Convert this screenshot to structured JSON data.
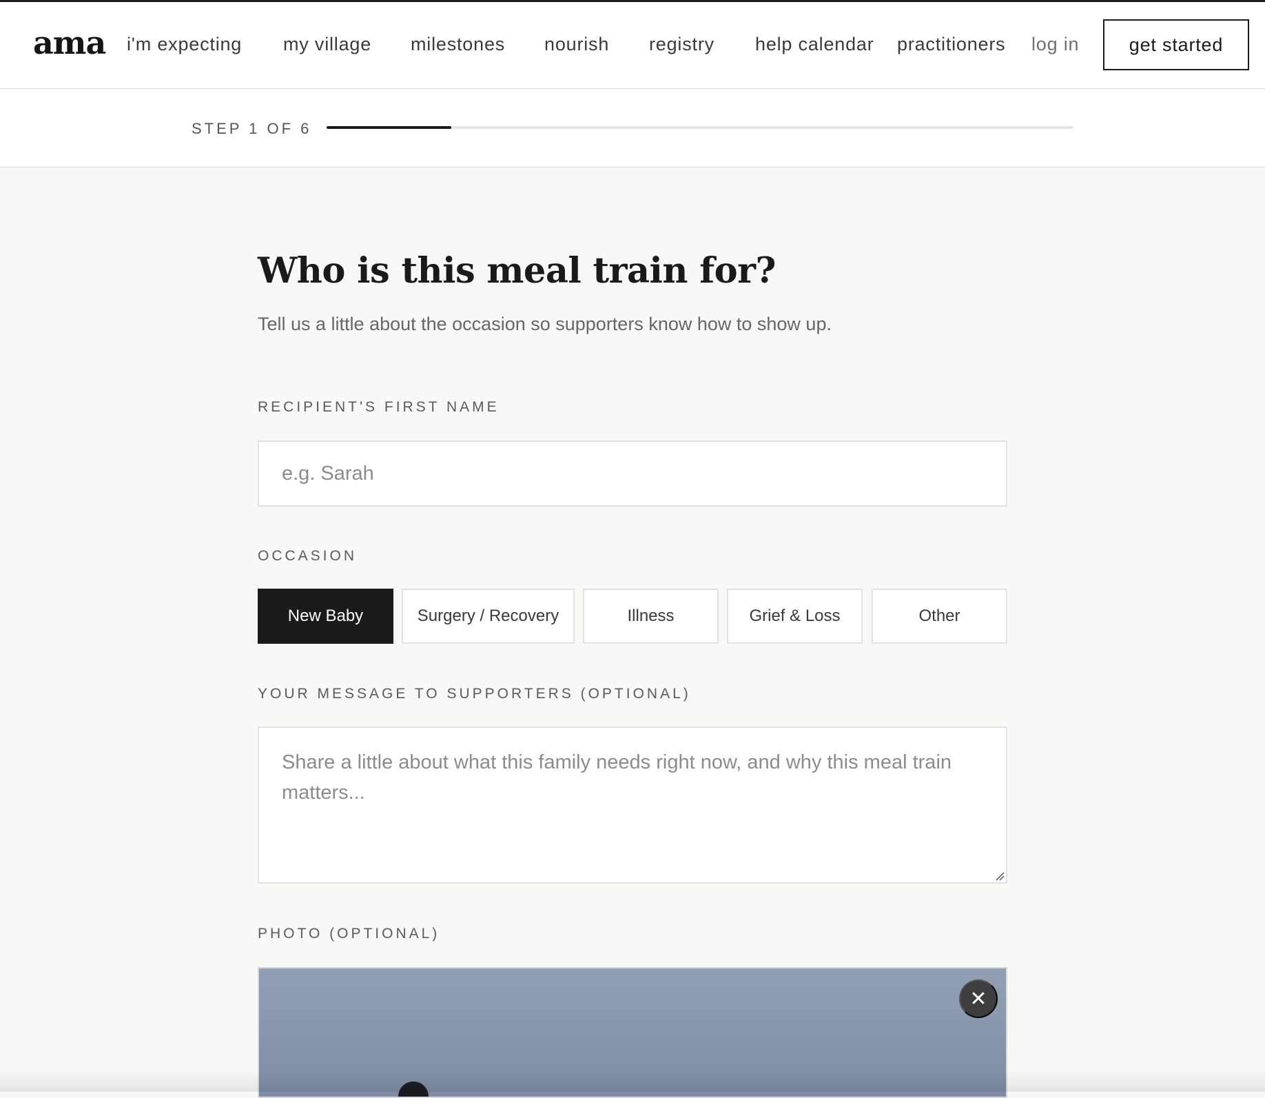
{
  "header": {
    "logo": "ama",
    "nav": [
      {
        "label": "i'm expecting"
      },
      {
        "label": "my village"
      },
      {
        "label": "milestones"
      },
      {
        "label": "nourish"
      },
      {
        "label": "registry"
      },
      {
        "label": "help calendar"
      },
      {
        "label": "practitioners"
      }
    ],
    "login_label": "log in",
    "cta_label": "get started"
  },
  "stepper": {
    "text": "STEP 1 OF 6",
    "progress_fraction": 0.1667
  },
  "form": {
    "title": "Who is this meal train for?",
    "subtitle": "Tell us a little about the occasion so supporters know how to show up.",
    "name_label": "RECIPIENT'S FIRST NAME",
    "name_placeholder": "e.g. Sarah",
    "name_value": "",
    "occasion_label": "OCCASION",
    "occasions": [
      {
        "label": "New Baby",
        "selected": true
      },
      {
        "label": "Surgery / Recovery",
        "selected": false
      },
      {
        "label": "Illness",
        "selected": false
      },
      {
        "label": "Grief & Loss",
        "selected": false
      },
      {
        "label": "Other",
        "selected": false
      }
    ],
    "message_label": "YOUR MESSAGE TO SUPPORTERS (OPTIONAL)",
    "message_placeholder": "Share a little about what this family needs right now, and why this meal train matters...",
    "message_value": "",
    "photo_label": "PHOTO (OPTIONAL)",
    "photo_remove_icon": "close-icon",
    "photo_remove_symbol": "✕"
  },
  "colors": {
    "accent": "#1b1b1b",
    "page_bg": "#f8f8f6",
    "border": "#e2e2de"
  }
}
